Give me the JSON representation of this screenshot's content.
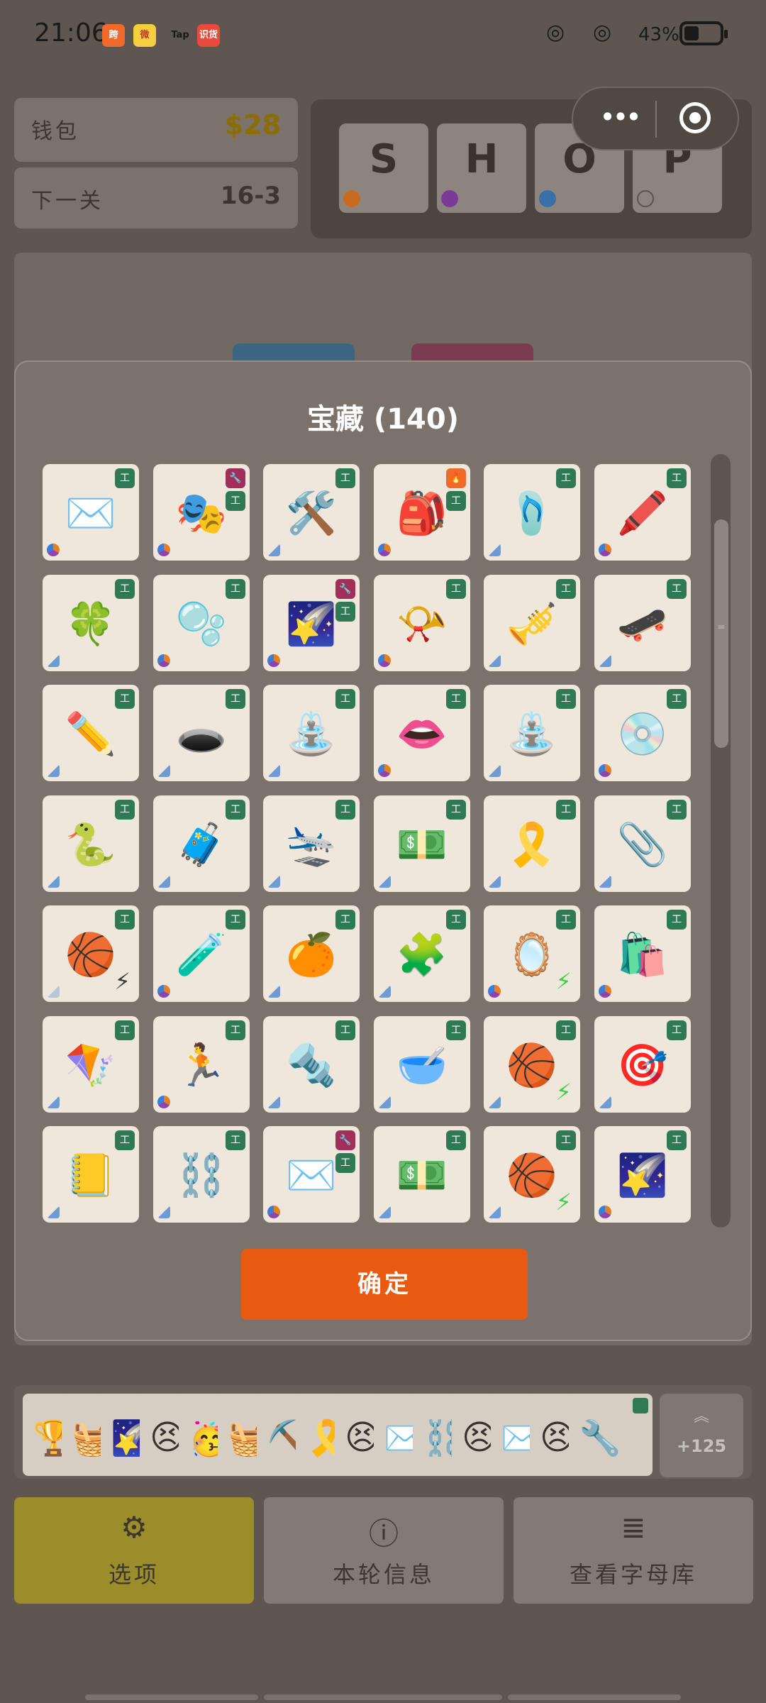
{
  "status_bar": {
    "time": "21:06",
    "battery": "43%",
    "apps": [
      {
        "label": "跨",
        "color": "#f06b2b"
      },
      {
        "label": "微",
        "color": "#ffffff"
      },
      {
        "label": "Tap",
        "color": "#3a3a3a"
      },
      {
        "label": "识货",
        "color": "#e84b3c"
      }
    ]
  },
  "wallet": {
    "label": "钱包",
    "value": "$28",
    "value_color": "#8c6d00"
  },
  "next_level": {
    "label": "下一关",
    "value": "16-3"
  },
  "shop_tiles": [
    {
      "letter": "S",
      "dot": "#c86a1f"
    },
    {
      "letter": "H",
      "dot": "#7a3a9a"
    },
    {
      "letter": "O",
      "dot": "#3b6fa8"
    },
    {
      "letter": "P",
      "dot": "transparent"
    }
  ],
  "modal": {
    "title": "宝藏 (140)",
    "confirm_label": "确定",
    "items": [
      {
        "icon": "✉️",
        "name": "envelope",
        "badges": [
          "工"
        ],
        "corner": "orb"
      },
      {
        "icon": "🎭",
        "name": "performing-arts",
        "badges": [
          "🔧",
          "工"
        ],
        "corner": "orb"
      },
      {
        "icon": "🛠️",
        "name": "hammer-and-wrench",
        "badges": [
          "工"
        ],
        "corner": "dia"
      },
      {
        "icon": "🎒",
        "name": "backpack",
        "badges": [
          "🔥",
          "工"
        ],
        "corner": "orb"
      },
      {
        "icon": "🩴",
        "name": "flip-flop",
        "badges": [
          "工"
        ],
        "corner": "dia"
      },
      {
        "icon": "🖍️",
        "name": "crayon",
        "badges": [
          "工"
        ],
        "corner": "orb"
      },
      {
        "icon": "🍀",
        "name": "four-leaf-clover",
        "badges": [
          "工"
        ],
        "corner": "dia"
      },
      {
        "icon": "🫧",
        "name": "bubbles",
        "badges": [
          "工"
        ],
        "corner": "orb"
      },
      {
        "icon": "🌠",
        "name": "shooting-star",
        "badges": [
          "🔧",
          "工"
        ],
        "corner": "orb"
      },
      {
        "icon": "📯",
        "name": "postal-horn",
        "badges": [
          "工"
        ],
        "corner": "orb"
      },
      {
        "icon": "🎺",
        "name": "trumpet",
        "badges": [
          "工"
        ],
        "corner": "dia"
      },
      {
        "icon": "🛹",
        "name": "skateboard",
        "badges": [
          "工"
        ],
        "corner": "dia"
      },
      {
        "icon": "✏️",
        "name": "pencil",
        "badges": [
          "工"
        ],
        "corner": "dia"
      },
      {
        "icon": "🕳️",
        "name": "hole",
        "badges": [
          "工"
        ],
        "corner": "dia"
      },
      {
        "icon": "⛲",
        "name": "fountain",
        "badges": [
          "工"
        ],
        "corner": "dia"
      },
      {
        "icon": "👄",
        "name": "mouth",
        "badges": [
          "工"
        ],
        "corner": "orb"
      },
      {
        "icon": "⛲",
        "name": "fountain",
        "badges": [
          "工"
        ],
        "corner": "dia"
      },
      {
        "icon": "💿",
        "name": "optical-disc",
        "badges": [
          "工"
        ],
        "corner": "orb"
      },
      {
        "icon": "🐍",
        "name": "snake",
        "badges": [
          "工"
        ],
        "corner": "dia"
      },
      {
        "icon": "🧳",
        "name": "luggage",
        "badges": [
          "工"
        ],
        "corner": "dia"
      },
      {
        "icon": "🛬",
        "name": "airplane-arrival",
        "badges": [
          "工"
        ],
        "corner": "dia"
      },
      {
        "icon": "💵",
        "name": "dollar-banknote",
        "badges": [
          "工"
        ],
        "corner": "dia"
      },
      {
        "icon": "🎗️",
        "name": "ribbon",
        "badges": [
          "工"
        ],
        "corner": "dia"
      },
      {
        "icon": "📎",
        "name": "paperclip",
        "badges": [
          "工"
        ],
        "corner": "dia"
      },
      {
        "icon": "🏀",
        "name": "basketball",
        "badges": [
          "工"
        ],
        "corner": "pale",
        "bolt": "⚡"
      },
      {
        "icon": "🧪",
        "name": "test-tube",
        "badges": [
          "工"
        ],
        "corner": "orb"
      },
      {
        "icon": "🍊",
        "name": "tangerine",
        "badges": [
          "工"
        ],
        "corner": "dia"
      },
      {
        "icon": "🧩",
        "name": "puzzle-piece",
        "badges": [
          "工"
        ],
        "corner": "dia"
      },
      {
        "icon": "🪞",
        "name": "mirror",
        "badges": [
          "工"
        ],
        "corner": "orb",
        "bolt": "⚡"
      },
      {
        "icon": "🛍️",
        "name": "shopping-bags",
        "badges": [
          "工"
        ],
        "corner": "orb"
      },
      {
        "icon": "🪁",
        "name": "kite",
        "badges": [
          "工"
        ],
        "corner": "dia"
      },
      {
        "icon": "🏃",
        "name": "runner",
        "badges": [
          "工"
        ],
        "corner": "orb"
      },
      {
        "icon": "🔩",
        "name": "nut-and-bolt",
        "badges": [
          "工"
        ],
        "corner": "dia"
      },
      {
        "icon": "🥣",
        "name": "bowl-with-spoon",
        "badges": [
          "工"
        ],
        "corner": "dia"
      },
      {
        "icon": "🏀",
        "name": "basketball",
        "badges": [
          "工"
        ],
        "corner": "dia",
        "bolt": "⚡"
      },
      {
        "icon": "🎯",
        "name": "direct-hit",
        "badges": [
          "工"
        ],
        "corner": "dia"
      },
      {
        "icon": "📒",
        "name": "ledger",
        "badges": [
          "工"
        ],
        "corner": "dia"
      },
      {
        "icon": "⛓️",
        "name": "chains",
        "badges": [
          "工"
        ],
        "corner": "dia"
      },
      {
        "icon": "✉️",
        "name": "envelope",
        "badges": [
          "🔧",
          "工"
        ],
        "corner": "orb"
      },
      {
        "icon": "💵",
        "name": "dollar-banknote",
        "badges": [
          "工"
        ],
        "corner": "dia"
      },
      {
        "icon": "🏀",
        "name": "basketball",
        "badges": [
          "工"
        ],
        "corner": "dia",
        "bolt": "⚡"
      },
      {
        "icon": "🌠",
        "name": "shooting-star",
        "badges": [
          "工"
        ],
        "corner": "orb"
      }
    ]
  },
  "hand": {
    "cards": [
      {
        "icon": "🏆",
        "badge": "#2f7a55"
      },
      {
        "icon": "🧺",
        "badge": "#a0305a"
      },
      {
        "icon": "🌠",
        "badge": "#2f5aa0"
      },
      {
        "icon": "😣",
        "badge": "#2f7a55"
      },
      {
        "icon": "🥳",
        "badge": "#2f7a55"
      },
      {
        "icon": "🧺",
        "badge": "#2f5aa0"
      },
      {
        "icon": "⛏️",
        "badge": "#2f7a55"
      },
      {
        "icon": "🎗️",
        "badge": "#2f7a55"
      },
      {
        "icon": "😣",
        "badge": "#a0305a"
      },
      {
        "icon": "✉️",
        "badge": "#2f7a55"
      },
      {
        "icon": "⛓️",
        "badge": "#2f7a55"
      },
      {
        "icon": "😣",
        "badge": "#2f5aa0"
      },
      {
        "icon": "✉️",
        "badge": "#2f7a55"
      },
      {
        "icon": "😣",
        "badge": "#a0305a"
      },
      {
        "icon": "🔧",
        "badge": "#2f7a55"
      }
    ],
    "more_count": "+125"
  },
  "buttons": [
    {
      "label": "选项",
      "icon": "⚙"
    },
    {
      "label": "本轮信息",
      "icon": "ⓘ"
    },
    {
      "label": "查看字母库",
      "icon": "≣"
    }
  ],
  "colors": {
    "accent": "#e85a12",
    "badge_green": "#2f7a55",
    "badge_crimson": "#a0305a",
    "badge_orange": "#f06b2b"
  }
}
